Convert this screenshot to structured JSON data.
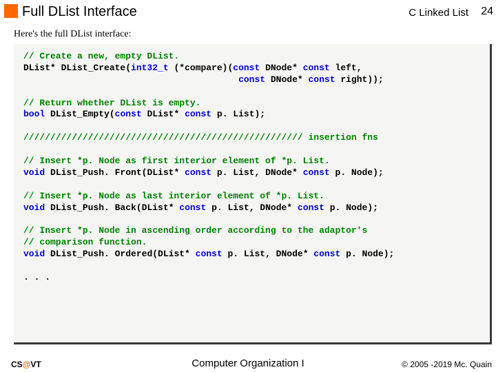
{
  "header": {
    "title": "Full DList Interface",
    "topic": "C Linked List",
    "slide_no": "24"
  },
  "intro": "Here's the full DList interface:",
  "code": {
    "c1": "// Create a new, empty DList.",
    "l1a": "DList* DList_Create(",
    "l1b": "int32_t",
    "l1c": " (*compare)(",
    "l1d": "const",
    "l1e": " DNode* ",
    "l1f": "const",
    "l1g": " left,",
    "l1h": "                                        ",
    "l1i": "const",
    "l1j": " DNode* ",
    "l1k": "const",
    "l1l": " right));",
    "c2": "// Return whether DList is empty.",
    "l2a": "bool",
    "l2b": " DList_Empty(",
    "l2c": "const",
    "l2d": " DList* ",
    "l2e": "const",
    "l2f": " p. List);",
    "sep": "//////////////////////////////////////////////////// insertion fns",
    "c3": "// Insert *p. Node as first interior element of *p. List.",
    "l3a": "void",
    "l3b": " DList_Push. Front(DList* ",
    "l3c": "const",
    "l3d": " p. List, DNode* ",
    "l3e": "const",
    "l3f": " p. Node);",
    "c4": "// Insert *p. Node as last interior element of *p. List.",
    "l4a": "void",
    "l4b": " DList_Push. Back(DList* ",
    "l4c": "const",
    "l4d": " p. List, DNode* ",
    "l4e": "const",
    "l4f": " p. Node);",
    "c5a": "// Insert *p. Node in ascending order according to the adaptor's",
    "c5b": "// comparison function.",
    "l5a": "void",
    "l5b": " DList_Push. Ordered(DList* ",
    "l5c": "const",
    "l5d": " p. List, DNode* ",
    "l5e": "const",
    "l5f": " p. Node);",
    "ell": ". . ."
  },
  "footer": {
    "left_cs": "CS",
    "left_at": "@",
    "left_vt": "VT",
    "center": "Computer Organization I",
    "right": "© 2005 -2019 Mc. Quain"
  }
}
